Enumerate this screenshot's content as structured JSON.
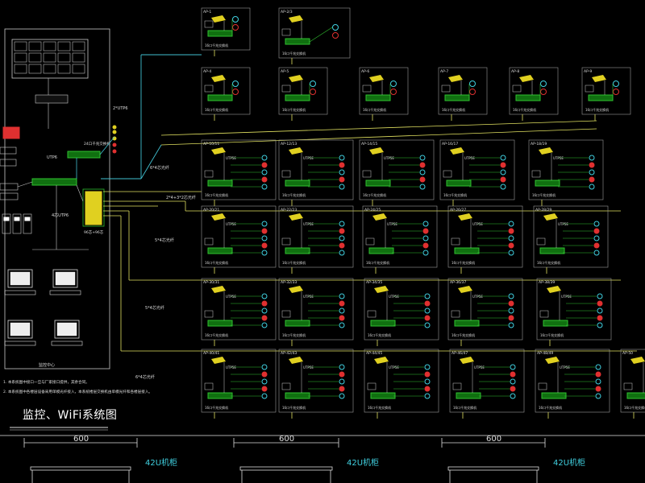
{
  "title": "监控、WiFi系统图",
  "control_center": "监控中心",
  "notes": [
    "1. 本系统图中接口一旦与厂家接口提供，其余合同。",
    "2. 本系统图中各楼层设备采用单模光纤接入，本系统楼层交换机由单模光纤和各楼层接入。"
  ],
  "cabinet_labels": {
    "width": "600",
    "rack": "42U机柜"
  },
  "cable_labels": [
    "2*UTP6",
    "6*4芯光纤",
    "2*4+3*2芯光纤",
    "5*4芯光纤",
    "5*4芯光纤",
    "6*4芯光纤",
    "4芯UTP6",
    "UTP6",
    "UTP6"
  ],
  "switch_labels": {
    "main_distribution": "96芯+96芯",
    "poe_switch": "24口千兆交换机",
    "floor_switch_16": "16口千兆交换机",
    "floor_switch_24": "24口千兆交换机",
    "floor_switch_8": "8口千兆交换机"
  },
  "row1_cells": [
    "AP-1",
    "AP-2/3"
  ],
  "row2_cells": [
    "AP-4",
    "AP-5",
    "AP-6",
    "AP-7",
    "AP-8",
    "AP-9"
  ],
  "row3_cells": [
    "AP-10/11",
    "AP-12/13",
    "AP-14/15",
    "AP-16/17",
    "AP-18/19"
  ],
  "row4_cells": [
    "AP-20/21",
    "AP-22/23",
    "AP-24/25",
    "AP-26/27",
    "AP-28/29"
  ],
  "row5_cells": [
    "AP-30/31",
    "AP-32/33",
    "AP-34/35",
    "AP-36/37",
    "AP-38/39"
  ],
  "row6_cells": [
    "AP-40/41",
    "AP-42/43",
    "AP-44/45",
    "AP-46/47",
    "AP-48/49",
    "AP-50"
  ],
  "small_texts": {
    "ups": "UTP5E",
    "fiber_box": "光纤配线架",
    "cores_18": "18芯光纤",
    "cores_8": "8芯光纤",
    "cores_4": "4芯光纤"
  },
  "colors": {
    "frame": "#c8c8c8",
    "cable_yellow": "#e0e060",
    "cable_cyan": "#40c0d0",
    "switch_green": "#30c030",
    "ap_red": "#e03030",
    "ap_cyan": "#40d0e0",
    "device_yellow": "#e0d020"
  }
}
